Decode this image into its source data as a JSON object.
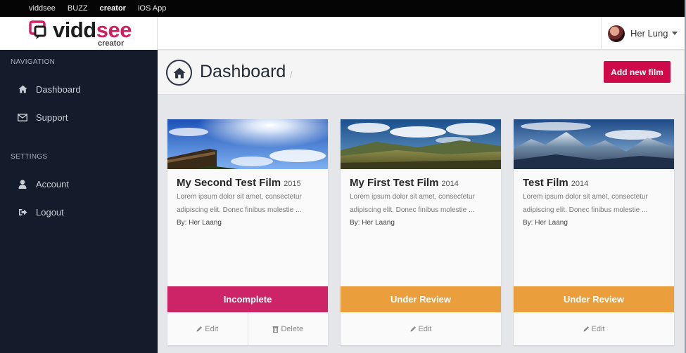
{
  "topnav": {
    "items": [
      "viddsee",
      "BUZZ",
      "creator",
      "iOS App"
    ],
    "active": "creator"
  },
  "logo": {
    "text_a": "vidd",
    "text_b": "see",
    "sub": "creator",
    "brand_color": "#d21f63"
  },
  "user": {
    "name": "Her Lung"
  },
  "sidebar": {
    "nav_heading": "NAVIGATION",
    "nav_items": [
      {
        "label": "Dashboard",
        "icon": "home-icon"
      },
      {
        "label": "Support",
        "icon": "envelope-icon"
      }
    ],
    "settings_heading": "SETTINGS",
    "settings_items": [
      {
        "label": "Account",
        "icon": "user-icon"
      },
      {
        "label": "Logout",
        "icon": "logout-icon"
      }
    ]
  },
  "page": {
    "title": "Dashboard",
    "slash": "/",
    "add_button": "Add new film"
  },
  "films": [
    {
      "title": "My Second Test Film",
      "year": "2015",
      "desc": "Lorem ipsum dolor sit amet, consectetur adipiscing elit. Donec finibus molestie ...",
      "by": "By: Her Laang",
      "status": "Incomplete",
      "status_color": "#cc2466",
      "actions": [
        "Edit",
        "Delete"
      ]
    },
    {
      "title": "My First Test Film",
      "year": "2014",
      "desc": "Lorem ipsum dolor sit amet, consectetur adipiscing elit. Donec finibus molestie ...",
      "by": "By: Her Laang",
      "status": "Under Review",
      "status_color": "#eb9f3c",
      "actions": [
        "Edit"
      ]
    },
    {
      "title": "Test Film",
      "year": "2014",
      "desc": "Lorem ipsum dolor sit amet, consectetur adipiscing elit. Donec finibus molestie ...",
      "by": "By: Her Laang",
      "status": "Under Review",
      "status_color": "#eb9f3c",
      "actions": [
        "Edit"
      ]
    }
  ]
}
